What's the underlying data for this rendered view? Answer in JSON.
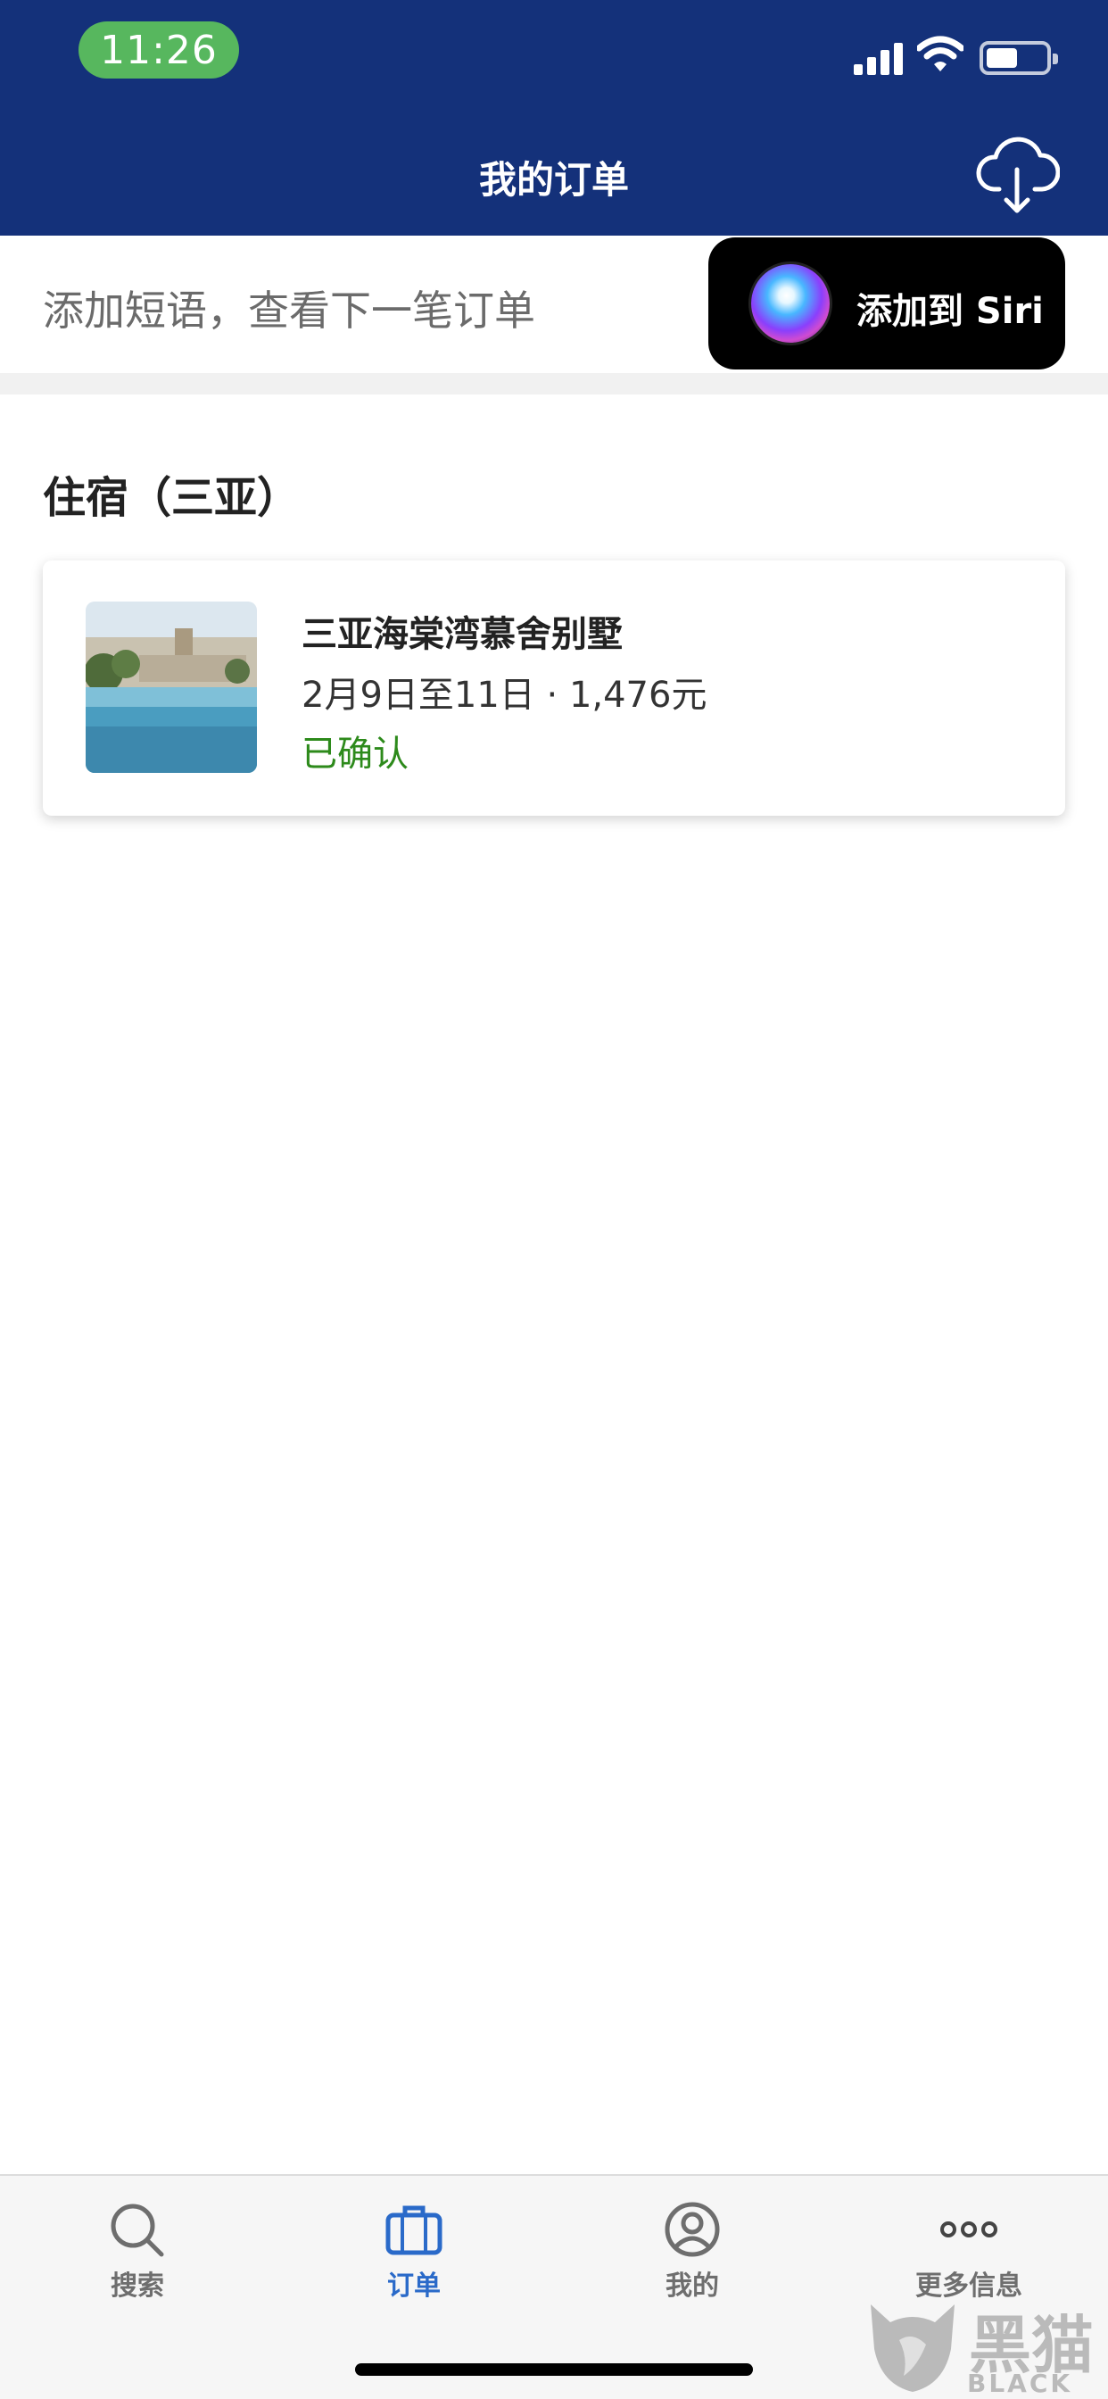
{
  "status_bar": {
    "time": "11:26"
  },
  "header": {
    "title": "我的订单",
    "action_icon": "cloud-download-icon"
  },
  "siri": {
    "phrase": "添加短语，查看下一笔订单",
    "button_label": "添加到 Siri"
  },
  "section": {
    "title": "住宿（三亚）"
  },
  "booking": {
    "name": "三亚海棠湾慕舍别墅",
    "dates_price": "2月9日至11日 · 1,476元",
    "status": "已确认",
    "status_color": "#2d8a1b"
  },
  "tabs": [
    {
      "label": "搜索",
      "icon": "search-icon",
      "active": false
    },
    {
      "label": "订单",
      "icon": "briefcase-icon",
      "active": true
    },
    {
      "label": "我的",
      "icon": "profile-icon",
      "active": false
    },
    {
      "label": "更多信息",
      "icon": "more-icon",
      "active": false
    }
  ],
  "watermark": {
    "text": "黑猫",
    "subtext": "BLACK CAT"
  },
  "colors": {
    "header_bg": "#14317a",
    "accent": "#2a6ac9"
  }
}
